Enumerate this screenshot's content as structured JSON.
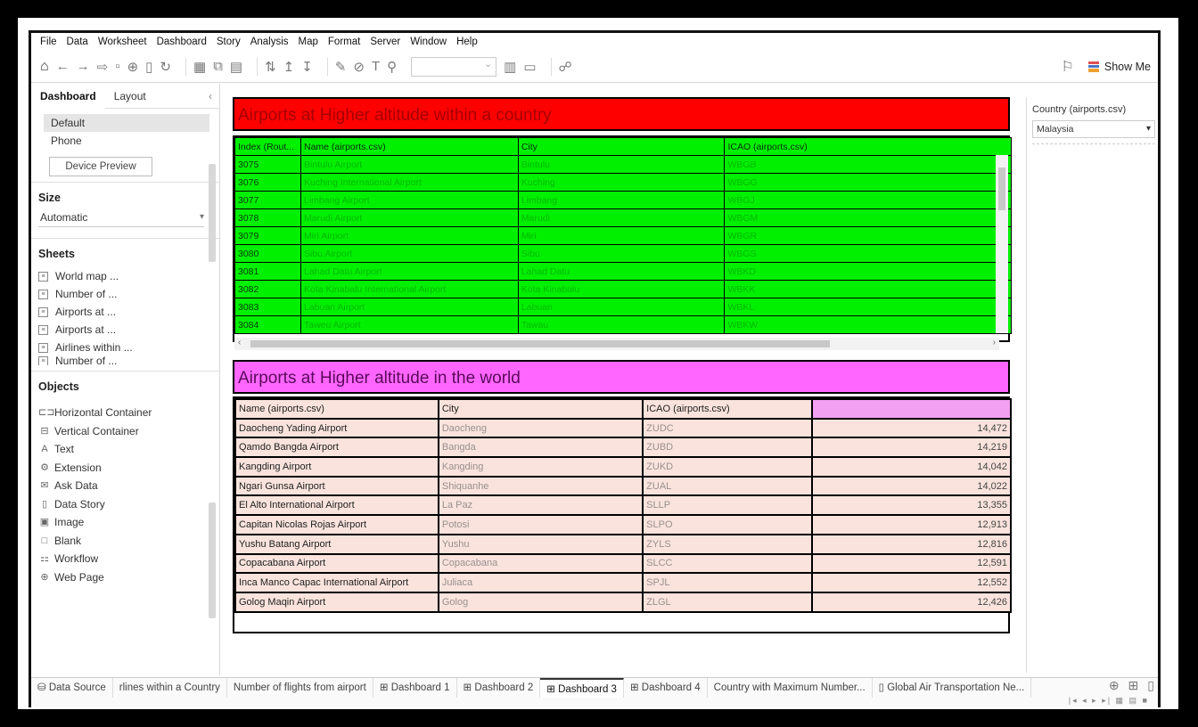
{
  "menu": [
    "File",
    "Data",
    "Worksheet",
    "Dashboard",
    "Story",
    "Analysis",
    "Map",
    "Format",
    "Server",
    "Window",
    "Help"
  ],
  "toolbar": {
    "show_me": "Show Me"
  },
  "left_panel": {
    "tabs": [
      "Dashboard",
      "Layout"
    ],
    "devices": [
      "Default",
      "Phone"
    ],
    "device_preview": "Device Preview",
    "size_label": "Size",
    "size_value": "Automatic",
    "sheets_label": "Sheets",
    "sheets": [
      "World map ...",
      "Number of ...",
      "Airports at ...",
      "Airports at ...",
      "Airlines within ...",
      "Number of ..."
    ],
    "objects_label": "Objects",
    "objects": [
      {
        "icon": "horizontal-container-icon",
        "label": "Horizontal Container"
      },
      {
        "icon": "vertical-container-icon",
        "label": "Vertical Container"
      },
      {
        "icon": "text-icon",
        "label": "Text"
      },
      {
        "icon": "extension-icon",
        "label": "Extension"
      },
      {
        "icon": "ask-data-icon",
        "label": "Ask Data"
      },
      {
        "icon": "data-story-icon",
        "label": "Data Story"
      },
      {
        "icon": "image-icon",
        "label": "Image"
      },
      {
        "icon": "blank-icon",
        "label": "Blank"
      },
      {
        "icon": "workflow-icon",
        "label": "Workflow"
      },
      {
        "icon": "web-page-icon",
        "label": "Web Page"
      }
    ]
  },
  "country_table": {
    "title": "Airports at Higher altitude within a country",
    "headers": [
      "Index (Rout...",
      "Name (airports.csv)",
      "City",
      "ICAO (airports.csv)"
    ],
    "rows": [
      [
        "3075",
        "Bintulu Airport",
        "Bintulu",
        "WBGB"
      ],
      [
        "3076",
        "Kuching International Airport",
        "Kuching",
        "WBGG"
      ],
      [
        "3077",
        "Limbang Airport",
        "Limbang",
        "WBGJ"
      ],
      [
        "3078",
        "Marudi Airport",
        "Marudi",
        "WBGM"
      ],
      [
        "3079",
        "Miri Airport",
        "Miri",
        "WBGR"
      ],
      [
        "3080",
        "Sibu Airport",
        "Sibu",
        "WBGS"
      ],
      [
        "3081",
        "Lahad Datu Airport",
        "Lahad Datu",
        "WBKD"
      ],
      [
        "3082",
        "Kota Kinabalu International Airport",
        "Kota Kinabalu",
        "WBKK"
      ],
      [
        "3083",
        "Labuan Airport",
        "Labuan",
        "WBKL"
      ],
      [
        "3084",
        "Taweu Airport",
        "Tawau",
        "WBKW"
      ]
    ]
  },
  "world_table": {
    "title": "Airports at Higher altitude in the world",
    "headers": [
      "Name (airports.csv)",
      "City",
      "ICAO (airports.csv)",
      ""
    ],
    "rows": [
      [
        "Daocheng Yading Airport",
        "Daocheng",
        "ZUDC",
        "14,472"
      ],
      [
        "Qamdo Bangda Airport",
        "Bangda",
        "ZUBD",
        "14,219"
      ],
      [
        "Kangding Airport",
        "Kangding",
        "ZUKD",
        "14,042"
      ],
      [
        "Ngari Gunsa Airport",
        "Shiquanhe",
        "ZUAL",
        "14,022"
      ],
      [
        "El Alto International Airport",
        "La Paz",
        "SLLP",
        "13,355"
      ],
      [
        "Capitan Nicolas Rojas Airport",
        "Potosi",
        "SLPO",
        "12,913"
      ],
      [
        "Yushu Batang Airport",
        "Yushu",
        "ZYLS",
        "12,816"
      ],
      [
        "Copacabana Airport",
        "Copacabana",
        "SLCC",
        "12,591"
      ],
      [
        "Inca Manco Capac International Airport",
        "Juliaca",
        "SPJL",
        "12,552"
      ],
      [
        "Golog Maqin Airport",
        "Golog",
        "ZLGL",
        "12,426"
      ]
    ]
  },
  "filter": {
    "label": "Country (airports.csv)",
    "value": "Malaysia"
  },
  "bottom_tabs": [
    "Data Source",
    "rlines within a Country",
    "Number of flights from airport",
    "Dashboard 1",
    "Dashboard 2",
    "Dashboard 3",
    "Dashboard 4",
    "Country with Maximum Number...",
    "Global Air Transportation Ne..."
  ],
  "active_tab": "Dashboard 3",
  "colors": {
    "title_red": "#ff0000",
    "green": "#00f000",
    "title_pink": "#ff66ff",
    "table_pink": "#f9e3dc"
  }
}
